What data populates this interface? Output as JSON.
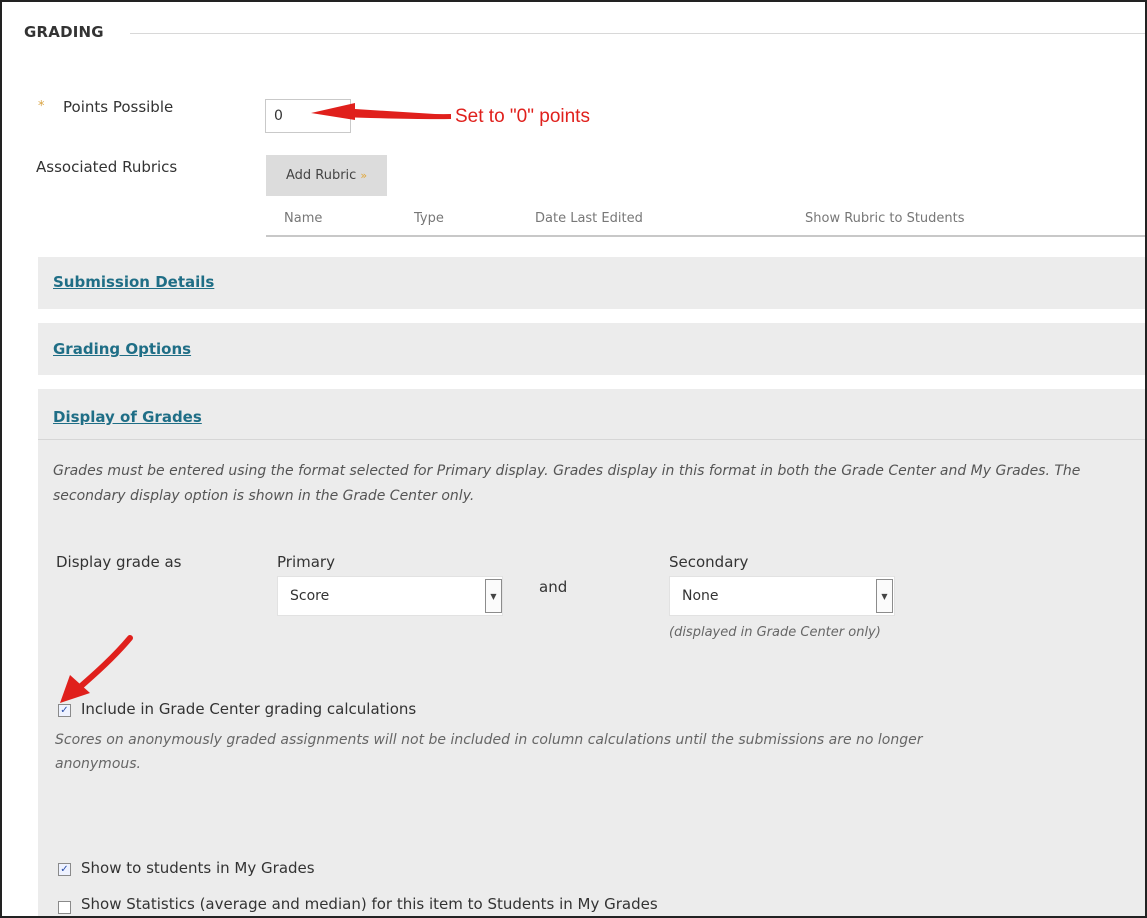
{
  "section": {
    "title": "GRADING"
  },
  "points": {
    "required_marker": "*",
    "label": "Points Possible",
    "value": "0"
  },
  "annotations": {
    "points_note": "Set to \"0\" points",
    "arrow_color": "#e0201c"
  },
  "rubrics": {
    "label": "Associated Rubrics",
    "add_button": "Add Rubric",
    "add_button_icon": "double-chevron-down-icon",
    "columns": [
      "Name",
      "Type",
      "Date Last Edited",
      "Show Rubric to Students"
    ]
  },
  "panels": {
    "submission_details": "Submission Details",
    "grading_options": "Grading Options",
    "display_of_grades": "Display of Grades"
  },
  "display": {
    "help_text": "Grades must be entered using the format selected for Primary display. Grades display in this format in both the Grade Center and My Grades. The secondary display option is shown in the Grade Center only.",
    "row_label": "Display grade as",
    "primary_label": "Primary",
    "primary_value": "Score",
    "and_text": "and",
    "secondary_label": "Secondary",
    "secondary_value": "None",
    "secondary_note": "(displayed in Grade Center only)"
  },
  "options": {
    "include_calc": {
      "label": "Include in Grade Center grading calculations",
      "checked": true
    },
    "include_note": "Scores on anonymously graded assignments will not be included in column calculations until the submissions are no longer anonymous.",
    "show_students": {
      "label": "Show to students in My Grades",
      "checked": true
    },
    "show_statistics": {
      "label": "Show Statistics (average and median) for this item to Students in My Grades",
      "checked": false
    }
  },
  "colors": {
    "link": "#1f6e86",
    "panel_bg": "#ececec",
    "required_star": "#d9a443",
    "checkbox_tick": "#2a4ea8"
  }
}
